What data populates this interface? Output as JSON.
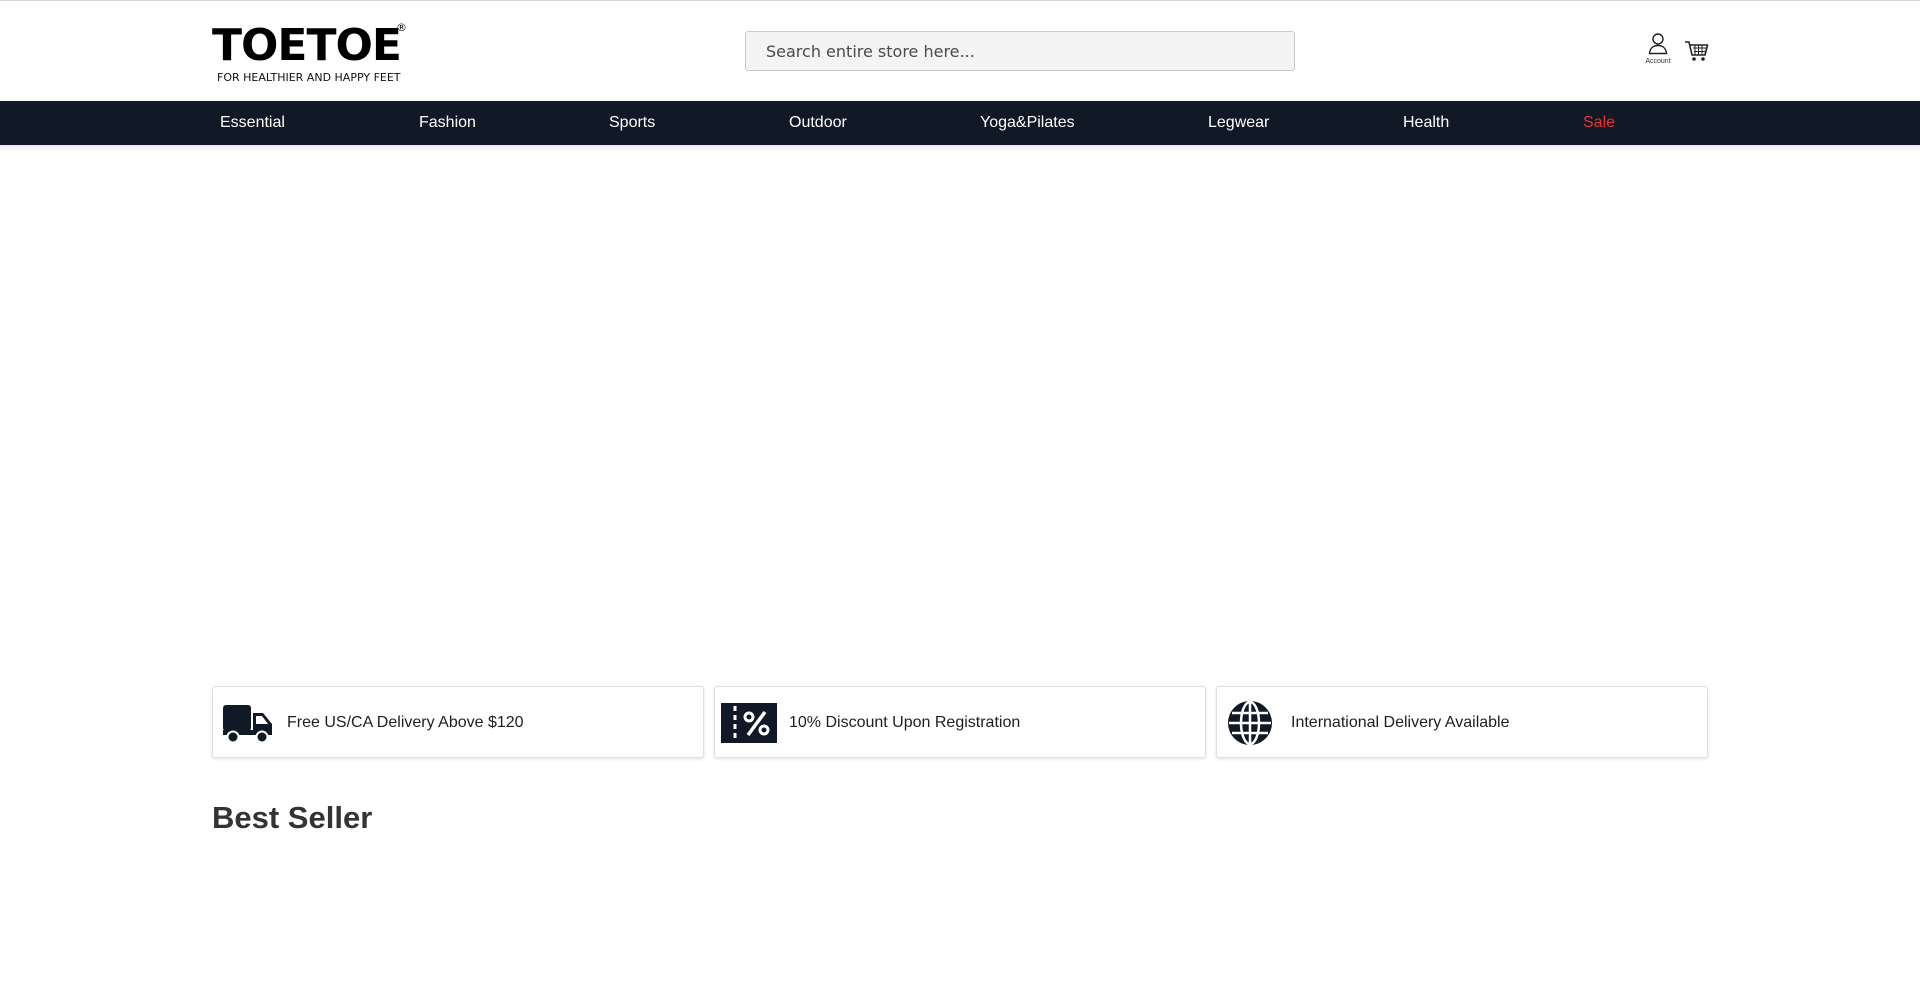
{
  "brand": {
    "name": "TOETOE",
    "registered": "®",
    "tagline": "FOR HEALTHIER AND HAPPY FEET"
  },
  "search": {
    "placeholder": "Search entire store here..."
  },
  "header_icons": {
    "account_label": "Account",
    "account_icon": "user-icon",
    "cart_icon": "cart-icon"
  },
  "nav": {
    "items": [
      {
        "label": "Essential"
      },
      {
        "label": "Fashion"
      },
      {
        "label": "Sports"
      },
      {
        "label": "Outdoor"
      },
      {
        "label": "Yoga&Pilates"
      },
      {
        "label": "Legwear"
      },
      {
        "label": "Health"
      },
      {
        "label": "Sale",
        "color": "#e8342c"
      }
    ]
  },
  "features": [
    {
      "icon": "truck-icon",
      "text": "Free US/CA Delivery Above $120"
    },
    {
      "icon": "discount-ticket-icon",
      "text": "10% Discount Upon Registration"
    },
    {
      "icon": "globe-icon",
      "text": "International Delivery Available"
    }
  ],
  "best_seller": {
    "title": "Best Seller"
  },
  "colors": {
    "nav_background": "#111826",
    "sale": "#e8342c",
    "heading": "#333333"
  }
}
